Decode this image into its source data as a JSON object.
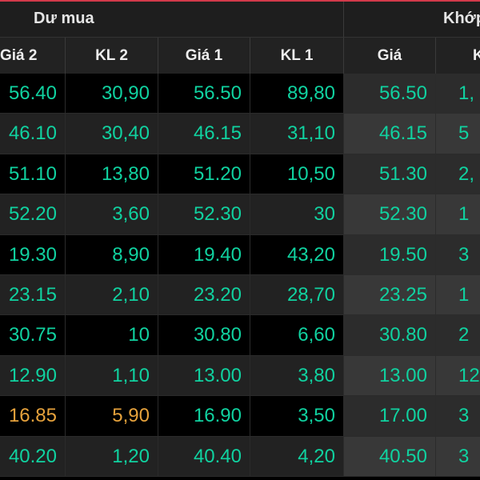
{
  "header": {
    "group_buy": "Dư mua",
    "group_match": "Khớp"
  },
  "columns": [
    "Giá 2",
    "KL 2",
    "Giá 1",
    "KL 1",
    "Giá",
    "K"
  ],
  "colors": {
    "up": "#10d2a0",
    "reference": "#e6a23c"
  },
  "rows": [
    {
      "gia2": "56.40",
      "kl2": "30,90",
      "gia1": "56.50",
      "kl1": "89,80",
      "khop_gia": "56.50",
      "khop_kl": "1,",
      "gia2_color": "#10d2a0",
      "kl2_color": "#10d2a0"
    },
    {
      "gia2": "46.10",
      "kl2": "30,40",
      "gia1": "46.15",
      "kl1": "31,10",
      "khop_gia": "46.15",
      "khop_kl": "5",
      "gia2_color": "#10d2a0",
      "kl2_color": "#10d2a0"
    },
    {
      "gia2": "51.10",
      "kl2": "13,80",
      "gia1": "51.20",
      "kl1": "10,50",
      "khop_gia": "51.30",
      "khop_kl": "2,",
      "gia2_color": "#10d2a0",
      "kl2_color": "#10d2a0"
    },
    {
      "gia2": "52.20",
      "kl2": "3,60",
      "gia1": "52.30",
      "kl1": "30",
      "khop_gia": "52.30",
      "khop_kl": "1",
      "gia2_color": "#10d2a0",
      "kl2_color": "#10d2a0"
    },
    {
      "gia2": "19.30",
      "kl2": "8,90",
      "gia1": "19.40",
      "kl1": "43,20",
      "khop_gia": "19.50",
      "khop_kl": "3",
      "gia2_color": "#10d2a0",
      "kl2_color": "#10d2a0"
    },
    {
      "gia2": "23.15",
      "kl2": "2,10",
      "gia1": "23.20",
      "kl1": "28,70",
      "khop_gia": "23.25",
      "khop_kl": "1",
      "gia2_color": "#10d2a0",
      "kl2_color": "#10d2a0"
    },
    {
      "gia2": "30.75",
      "kl2": "10",
      "gia1": "30.80",
      "kl1": "6,60",
      "khop_gia": "30.80",
      "khop_kl": "2",
      "gia2_color": "#10d2a0",
      "kl2_color": "#10d2a0"
    },
    {
      "gia2": "12.90",
      "kl2": "1,10",
      "gia1": "13.00",
      "kl1": "3,80",
      "khop_gia": "13.00",
      "khop_kl": "12",
      "gia2_color": "#10d2a0",
      "kl2_color": "#10d2a0"
    },
    {
      "gia2": "16.85",
      "kl2": "5,90",
      "gia1": "16.90",
      "kl1": "3,50",
      "khop_gia": "17.00",
      "khop_kl": "3",
      "gia2_color": "#e6a23c",
      "kl2_color": "#e6a23c"
    },
    {
      "gia2": "40.20",
      "kl2": "1,20",
      "gia1": "40.40",
      "kl1": "4,20",
      "khop_gia": "40.50",
      "khop_kl": "3",
      "gia2_color": "#10d2a0",
      "kl2_color": "#10d2a0"
    }
  ]
}
